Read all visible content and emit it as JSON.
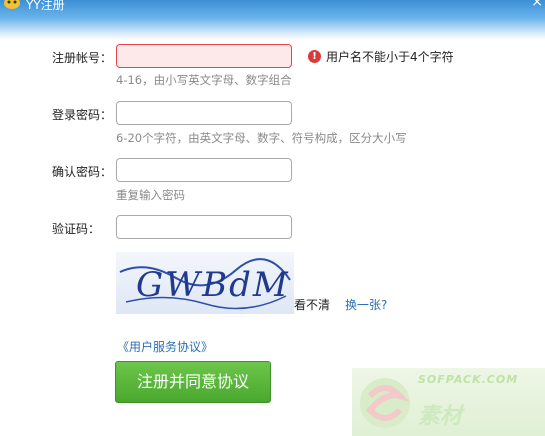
{
  "window": {
    "title": "YY注册",
    "close_glyph": "×"
  },
  "form": {
    "account": {
      "label": "注册帐号：",
      "value": "",
      "hint": "4-16，由小写英文字母、数字组合",
      "error": {
        "icon": "error-icon",
        "text": "用户名不能小于4个字符"
      }
    },
    "password": {
      "label": "登录密码：",
      "value": "",
      "hint": "6-20个字符，由英文字母、数字、符号构成，区分大小写"
    },
    "confirm": {
      "label": "确认密码：",
      "value": "",
      "hint": "重复输入密码"
    },
    "captcha": {
      "label": "验证码：",
      "value": "",
      "image_text": "GWBdM",
      "unclear_text": "看不清",
      "refresh_label": "换一张?"
    }
  },
  "terms_link": "《用户服务协议》",
  "submit_label": "注册并同意协议",
  "watermark": {
    "line1": "SOFPACK.COM",
    "line2": "素材"
  },
  "colors": {
    "accent_green": "#4aa72e",
    "link_blue": "#2b6fb3",
    "error_red": "#e0474d"
  }
}
